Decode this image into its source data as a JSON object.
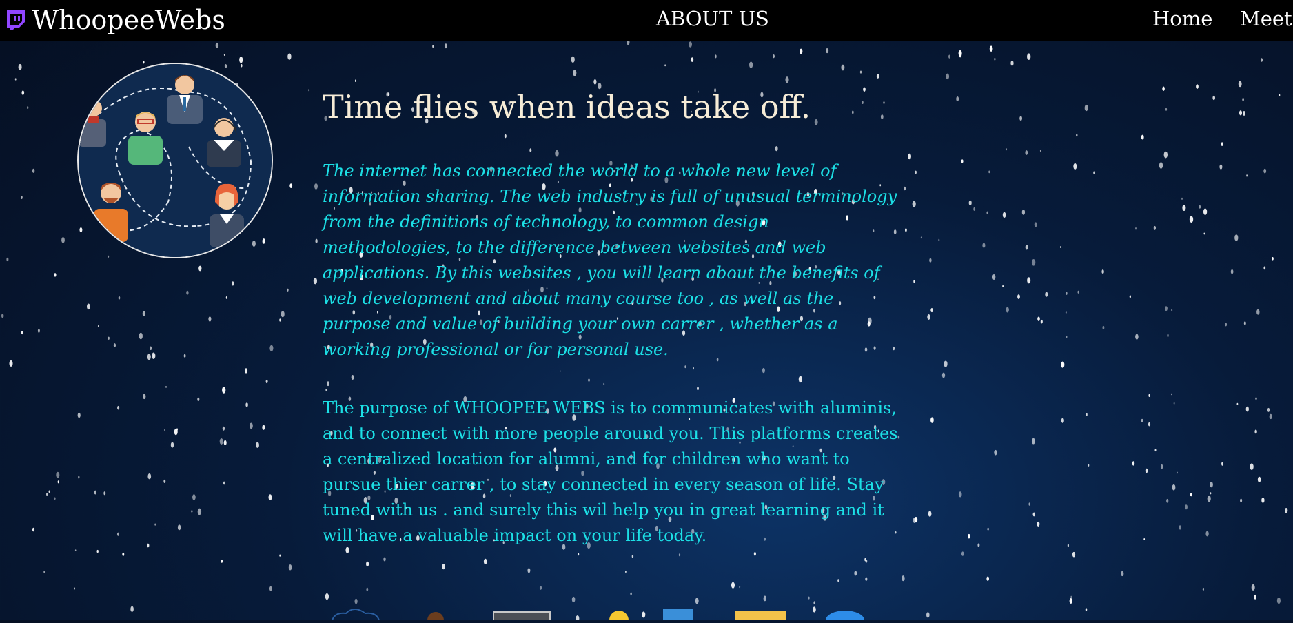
{
  "navbar": {
    "brand_icon": "twitch-logo-icon",
    "brand": "WhoopeeWebs",
    "center_title": "ABOUT US",
    "links": [
      {
        "label": "Home"
      },
      {
        "label": "Meet"
      }
    ]
  },
  "hero": {
    "image_icon": "networking-people-illustration",
    "headline": "Time flies when ideas take off.",
    "paragraph1": "The internet has connected the world to a whole new level of information sharing. The web industry is full of unusual terminology from the definitions of technology, to common design methodologies, to the difference between websites and web applications. By this websites , you will learn about the benefits of web development and about many course too , as well as the purpose and value of building your own carrer , whether as a working professional or for personal use.",
    "paragraph2": "The purpose of WHOOPEE WEBS is to communicates with aluminis, and to connect with more people around you. This platforms creates a centralized location for alumni, and for children who want to pursue thier carrer , to stay connected in every season of life. Stay tuned with us . and surely this wil help you in great learning and it will have a valuable impact on your life today."
  },
  "colors": {
    "navbar_bg": "#000000",
    "headline": "#f6ecd7",
    "body_text": "#1ce0e6",
    "brand_icon": "#9146ff",
    "background": "#071b3a"
  },
  "bottom_icons": [
    "cloud-icon",
    "person-icon",
    "monitor-icon",
    "smiley-icon",
    "document-icon",
    "folder-icon",
    "globe-icon"
  ]
}
